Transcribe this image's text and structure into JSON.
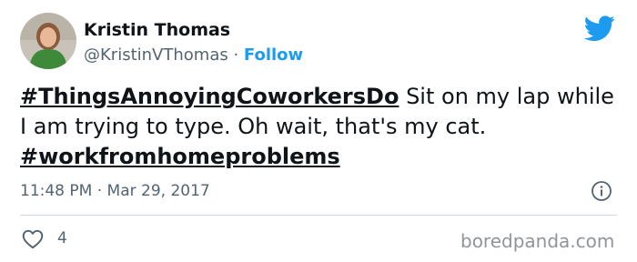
{
  "author": {
    "name": "Kristin Thomas",
    "handle": "@KristinVThomas",
    "separator": " · ",
    "follow_label": "Follow"
  },
  "tweet": {
    "hashtag_1": "#ThingsAnnoyingCoworkersDo",
    "text_1": " Sit on my lap while I am trying to type. Oh wait, that's my cat.",
    "hashtag_2": "#workfromhomeproblems",
    "timestamp": "11:48 PM · Mar 29, 2017"
  },
  "actions": {
    "like_count": "4"
  },
  "icons": {
    "brand": "twitter-bird-icon",
    "info": "info-icon",
    "like": "heart-icon"
  },
  "colors": {
    "accent": "#1d9bf0",
    "text": "#0f1419",
    "secondary": "#536471",
    "divider": "#cfd9de"
  },
  "watermark": "boredpanda.com"
}
